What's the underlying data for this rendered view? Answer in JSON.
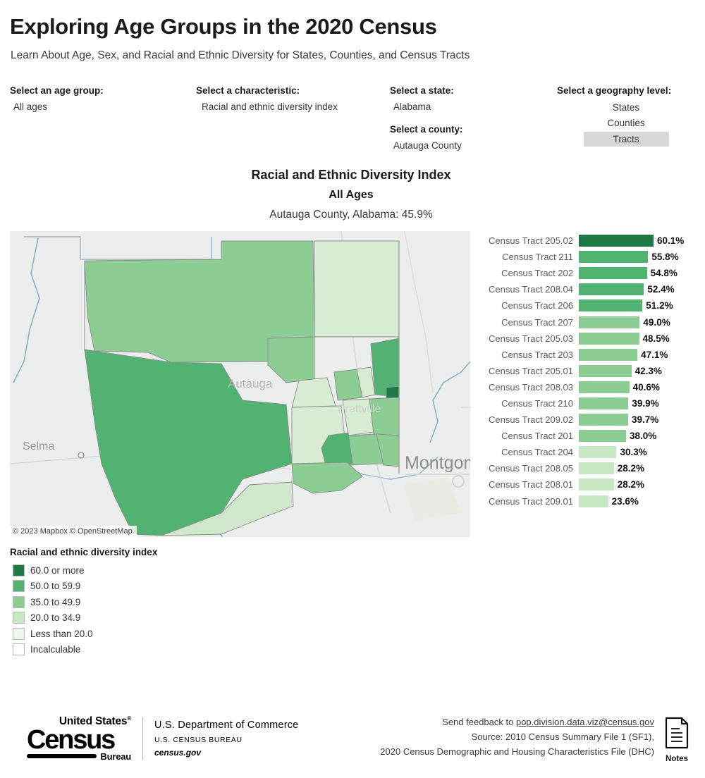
{
  "header": {
    "title": "Exploring Age Groups in the 2020 Census",
    "subtitle": "Learn About Age, Sex, and Racial and Ethnic Diversity for States, Counties, and Census Tracts"
  },
  "selectors": {
    "age_group": {
      "label": "Select an age group:",
      "value": "All ages"
    },
    "characteristic": {
      "label": "Select a characteristic:",
      "value": "Racial and ethnic diversity index"
    },
    "state": {
      "label": "Select a state:",
      "value": "Alabama"
    },
    "county": {
      "label": "Select a county:",
      "value": "Autauga County"
    },
    "geography_level": {
      "label": "Select a geography level:",
      "options": [
        "States",
        "Counties",
        "Tracts"
      ],
      "selected": "Tracts"
    }
  },
  "chart_header": {
    "title": "Racial and Ethnic Diversity Index",
    "subtitle": "All Ages",
    "location_value": "Autauga County, Alabama: 45.9%"
  },
  "map": {
    "attribution": "© 2023 Mapbox © OpenStreetMap",
    "city_labels": [
      "Selma",
      "Autauga",
      "Prattville",
      "Montgomery"
    ]
  },
  "legend": {
    "title": "Racial and ethnic diversity index",
    "items": [
      {
        "label": "60.0 or more",
        "color": "#1d7a45"
      },
      {
        "label": "50.0 to 59.9",
        "color": "#51b272"
      },
      {
        "label": "35.0 to 49.9",
        "color": "#8bcd92"
      },
      {
        "label": "20.0 to 34.9",
        "color": "#c7e7c5"
      },
      {
        "label": "Less than 20.0",
        "color": "#eef7ee"
      },
      {
        "label": "Incalculable",
        "color": "#ffffff"
      }
    ]
  },
  "chart_data": {
    "type": "bar",
    "title": "Racial and Ethnic Diversity Index",
    "subtitle": "All Ages",
    "xlabel": "",
    "ylabel": "",
    "orientation": "horizontal",
    "xlim": [
      0,
      60.1
    ],
    "grid": false,
    "legend_position": "below-map",
    "value_suffix": "%",
    "categories": [
      "Census Tract 205.02",
      "Census Tract 211",
      "Census Tract 202",
      "Census Tract 208.04",
      "Census Tract 206",
      "Census Tract 207",
      "Census Tract 205.03",
      "Census Tract 203",
      "Census Tract 205.01",
      "Census Tract 208.03",
      "Census Tract 210",
      "Census Tract 209.02",
      "Census Tract 201",
      "Census Tract 204",
      "Census Tract 208.05",
      "Census Tract 208.01",
      "Census Tract 209.01"
    ],
    "values": [
      60.1,
      55.8,
      54.8,
      52.4,
      51.2,
      49.0,
      48.5,
      47.1,
      42.3,
      40.6,
      39.9,
      39.7,
      38.0,
      30.3,
      28.2,
      28.2,
      23.6
    ],
    "value_labels": [
      "60.1%",
      "55.8%",
      "54.8%",
      "52.4%",
      "51.2%",
      "49.0%",
      "48.5%",
      "47.1%",
      "42.3%",
      "40.6%",
      "39.9%",
      "39.7%",
      "38.0%",
      "30.3%",
      "28.2%",
      "28.2%",
      "23.6%"
    ],
    "colors": [
      "#1d7a45",
      "#51b272",
      "#51b272",
      "#51b272",
      "#51b272",
      "#8bcd92",
      "#8bcd92",
      "#8bcd92",
      "#8bcd92",
      "#8bcd92",
      "#8bcd92",
      "#8bcd92",
      "#8bcd92",
      "#c7e7c5",
      "#c7e7c5",
      "#c7e7c5",
      "#c7e7c5"
    ]
  },
  "footer": {
    "logo": {
      "united_states": "United States",
      "registered": "®",
      "census": "Census",
      "bureau": "Bureau"
    },
    "department": {
      "line1": "U.S. Department of Commerce",
      "line2": "U.S. CENSUS BUREAU",
      "line3": "census.gov"
    },
    "feedback_prefix": "Send feedback to ",
    "feedback_email": "pop.division.data.viz@census.gov",
    "source_line1": "Source: 2010 Census Summary File 1 (SF1),",
    "source_line2": "2020 Census Demographic and Housing Characteristics File (DHC)",
    "notes_label": "Notes"
  }
}
